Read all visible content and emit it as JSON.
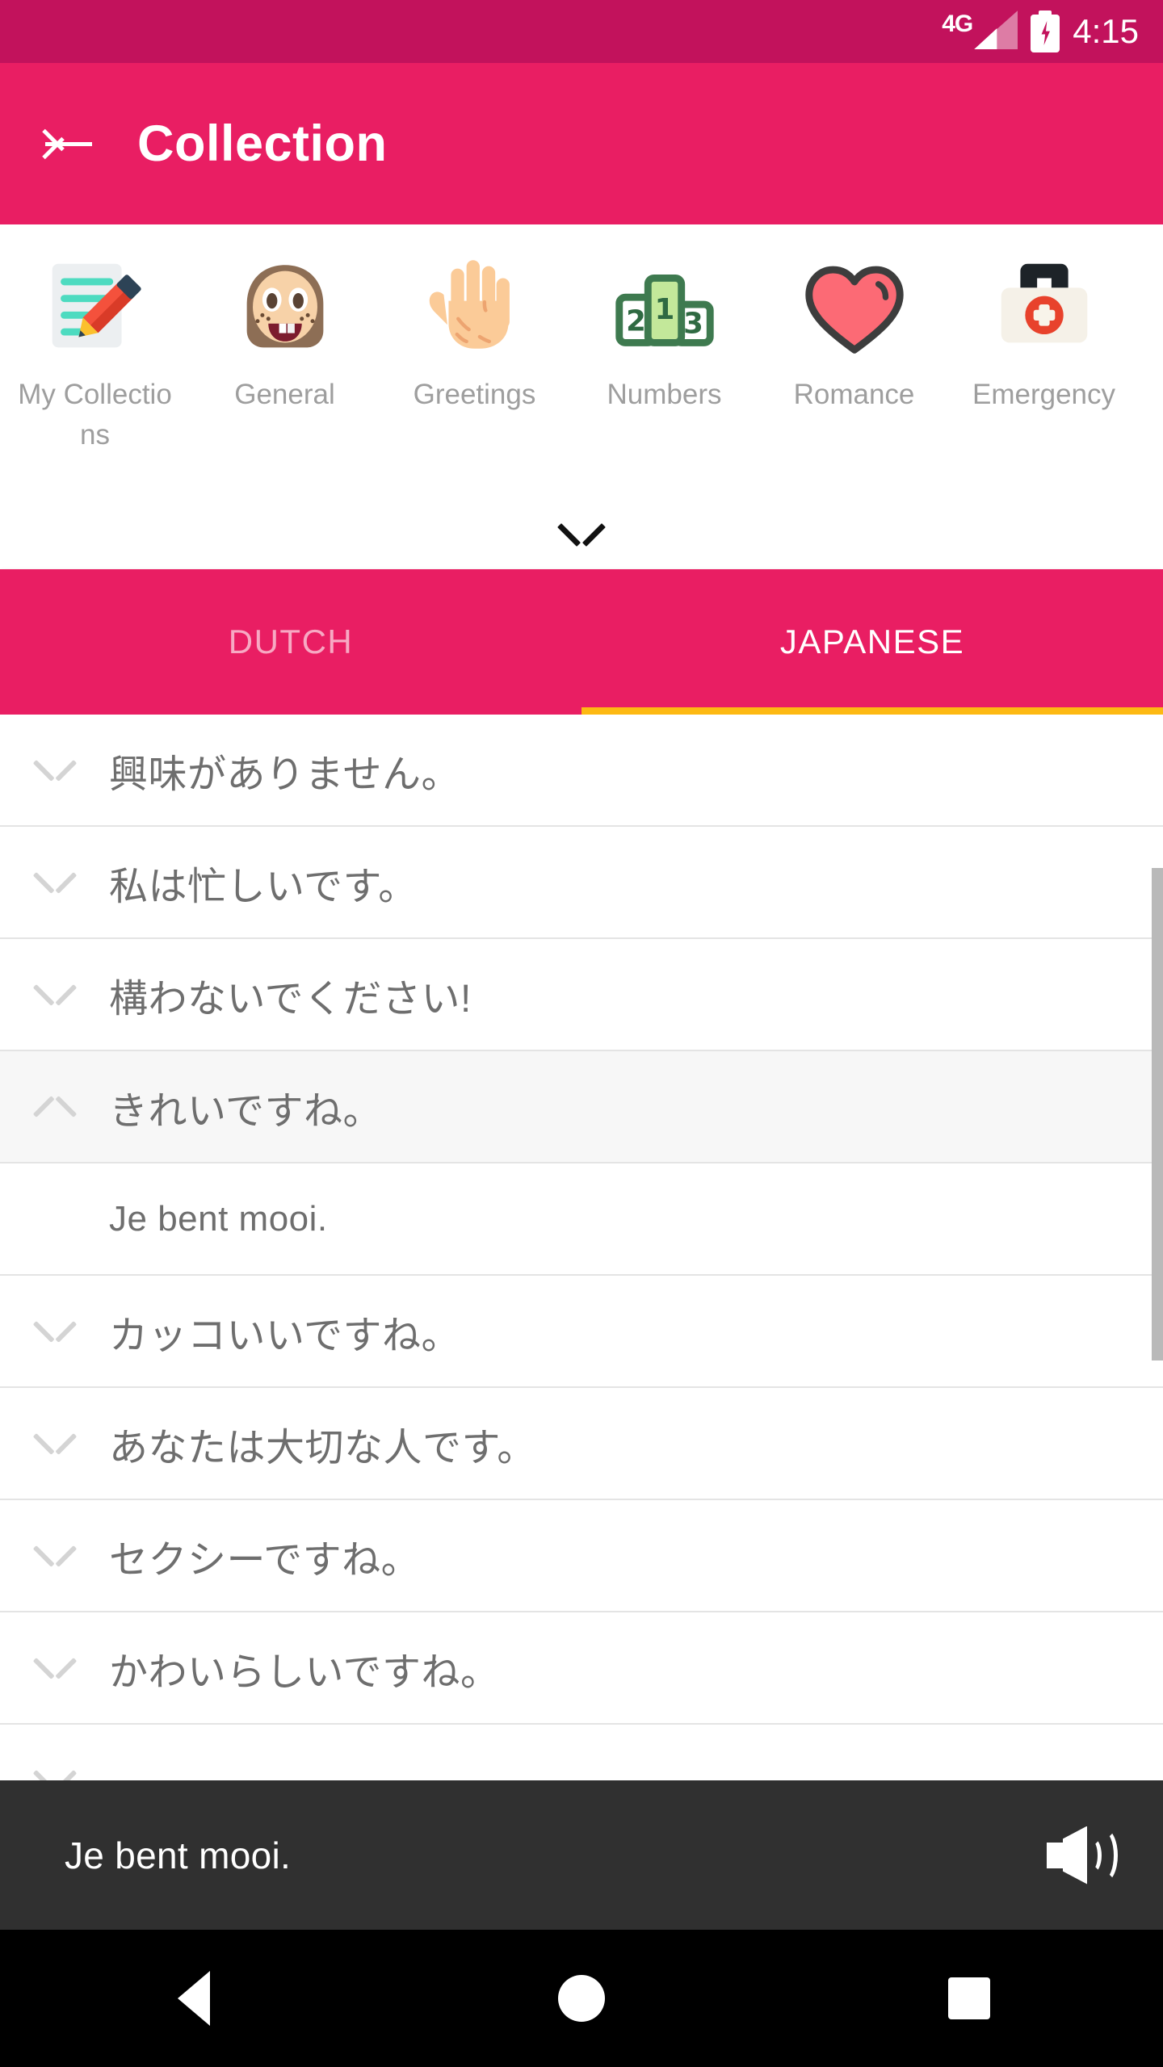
{
  "statusbar": {
    "network_label": "4G",
    "signal_icon": "signal-bars-icon",
    "battery_icon": "battery-charging-icon",
    "time": "4:15"
  },
  "appbar": {
    "back_icon": "arrow-left-icon",
    "title": "Collection"
  },
  "categories": {
    "expand_icon": "chevron-down-icon",
    "items": [
      {
        "label": "My Collections",
        "icon": "memo-pencil-icon"
      },
      {
        "label": "General",
        "icon": "girl-face-icon"
      },
      {
        "label": "Greetings",
        "icon": "raised-hand-icon"
      },
      {
        "label": "Numbers",
        "icon": "podium-123-icon"
      },
      {
        "label": "Romance",
        "icon": "heart-icon"
      },
      {
        "label": "Emergency",
        "icon": "first-aid-kit-icon"
      }
    ]
  },
  "tabs": {
    "items": [
      {
        "label": "DUTCH",
        "active": false
      },
      {
        "label": "JAPANESE",
        "active": true
      }
    ],
    "indicator_color": "#fdb913"
  },
  "phrase_list": {
    "rows": [
      {
        "text": "興味がありません。",
        "type": "phrase",
        "chevron": "chevron-down-icon",
        "selected": false
      },
      {
        "text": "私は忙しいです。",
        "type": "phrase",
        "chevron": "chevron-down-icon",
        "selected": false
      },
      {
        "text": "構わないでください!",
        "type": "phrase",
        "chevron": "chevron-down-icon",
        "selected": false
      },
      {
        "text": "きれいですね。",
        "type": "phrase",
        "chevron": "chevron-up-icon",
        "selected": true
      },
      {
        "text": "Je bent mooi.",
        "type": "translation",
        "chevron": "",
        "selected": false
      },
      {
        "text": "カッコいいですね。",
        "type": "phrase",
        "chevron": "chevron-down-icon",
        "selected": false
      },
      {
        "text": "あなたは大切な人です。",
        "type": "phrase",
        "chevron": "chevron-down-icon",
        "selected": false
      },
      {
        "text": "セクシーですね。",
        "type": "phrase",
        "chevron": "chevron-down-icon",
        "selected": false
      },
      {
        "text": "かわいらしいですね。",
        "type": "phrase",
        "chevron": "chevron-down-icon",
        "selected": false
      }
    ]
  },
  "audio_bar": {
    "phrase": "Je bent mooi.",
    "speaker_icon": "speaker-volume-icon"
  },
  "navbar": {
    "back_icon": "nav-back-triangle-icon",
    "home_icon": "nav-home-circle-icon",
    "recents_icon": "nav-recents-square-icon"
  },
  "colors": {
    "status_bar": "#c2125c",
    "app_bar": "#e91e63",
    "tab_indicator": "#fdb913",
    "audio_bar": "#303030"
  }
}
